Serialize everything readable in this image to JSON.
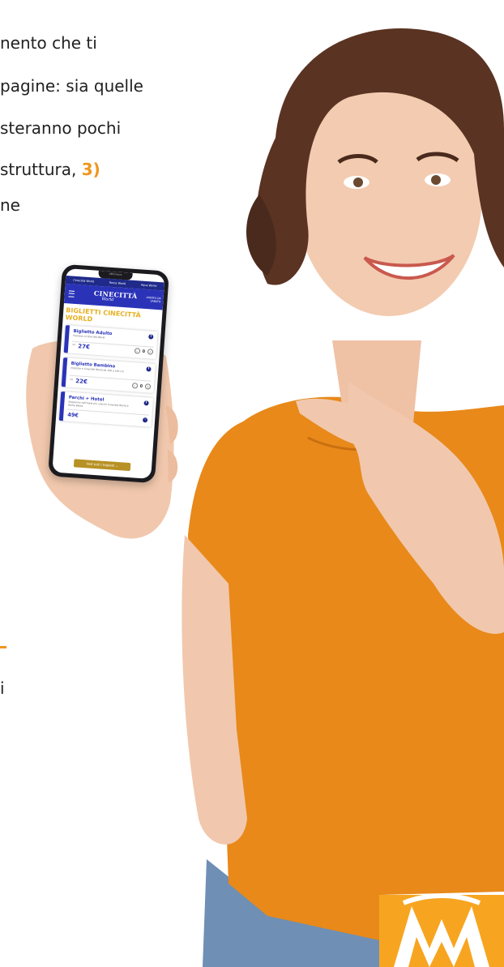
{
  "paragraph": {
    "line1": "nento che ti",
    "line2": " pagine: sia quelle",
    "line3_bold": "steranno pochi",
    "line4_text": " struttura, ",
    "line4_highlight": "3)",
    "line5": "ne",
    "line6": "i"
  },
  "phone": {
    "notch_text": "ABCorsura",
    "tabs": [
      "Cinecittà World",
      "Roma World",
      "Aqua World"
    ],
    "header": {
      "logo": "CINECITTÀ",
      "logo_sub": "World",
      "hours": "APERTO DA SABATO"
    },
    "page_title": "BIGLIETTI CINECITTÀ WORLD",
    "cards": [
      {
        "title": "Biglietto Adulto",
        "desc": "Ingresso a Cinecittà World",
        "pre": "da",
        "price": "27€",
        "qty": "0",
        "minus": "−",
        "plus": "+",
        "info": "i"
      },
      {
        "title": "Biglietto Bambino",
        "desc": "Ingresso a Cinecittà World da 100 a 140 cm",
        "pre": "da",
        "price": "22€",
        "qty": "0",
        "minus": "−",
        "plus": "+",
        "info": "i"
      },
      {
        "title": "Parchi + Hotel",
        "desc": "Soggiorno nell'hotel più i parchi Cinecittà World e Roma World",
        "price": "49€",
        "info": "i",
        "arrow": "›"
      }
    ],
    "cta": "Vedi tutti i biglietti ⌄"
  },
  "colors": {
    "accent_orange": "#f0961b",
    "brand_blue": "#2a33b8",
    "title_gold": "#e6b020",
    "tshirt": "#e8891a"
  }
}
